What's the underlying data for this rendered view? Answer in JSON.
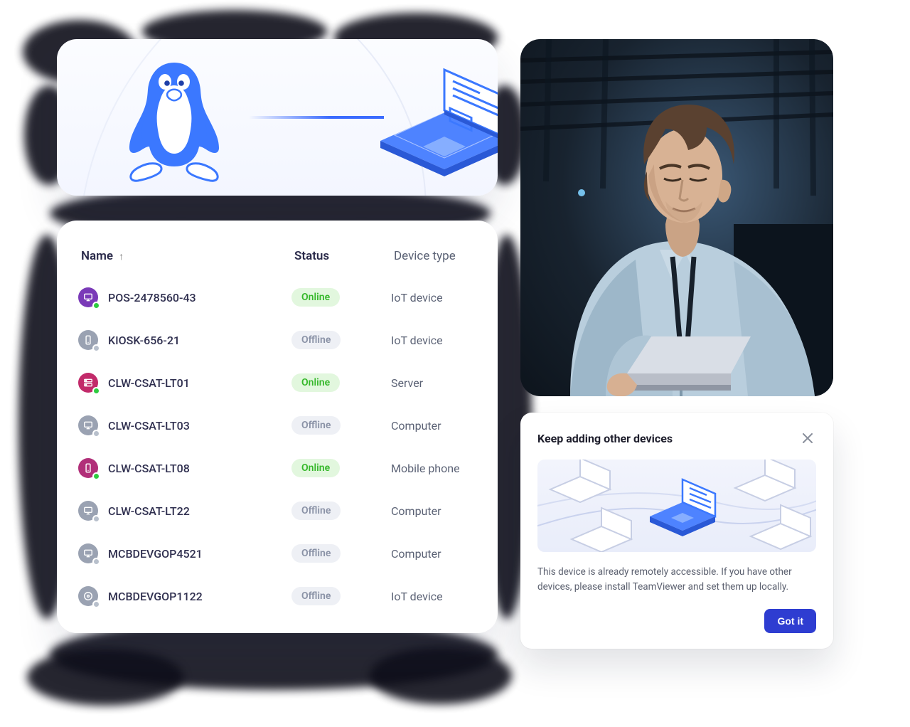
{
  "hero": {
    "source_os_icon": "linux-penguin",
    "target_device_icon": "laptop"
  },
  "table": {
    "headers": {
      "name": "Name",
      "status": "Status",
      "type": "Device type"
    },
    "sort_dir": "asc",
    "status_labels": {
      "online": "Online",
      "offline": "Offline"
    },
    "rows": [
      {
        "name": "POS-2478560-43",
        "status": "online",
        "type": "IoT device",
        "icon_color": "purple",
        "icon_glyph": "monitor"
      },
      {
        "name": "KIOSK-656-21",
        "status": "offline",
        "type": "IoT device",
        "icon_color": "grey",
        "icon_glyph": "phone"
      },
      {
        "name": "CLW-CSAT-LT01",
        "status": "online",
        "type": "Server",
        "icon_color": "pink",
        "icon_glyph": "server"
      },
      {
        "name": "CLW-CSAT-LT03",
        "status": "offline",
        "type": "Computer",
        "icon_color": "grey",
        "icon_glyph": "monitor"
      },
      {
        "name": "CLW-CSAT-LT08",
        "status": "online",
        "type": "Mobile phone",
        "icon_color": "magenta",
        "icon_glyph": "phone"
      },
      {
        "name": "CLW-CSAT-LT22",
        "status": "offline",
        "type": "Computer",
        "icon_color": "grey",
        "icon_glyph": "monitor"
      },
      {
        "name": "MCBDEVGOP4521",
        "status": "offline",
        "type": "Computer",
        "icon_color": "grey",
        "icon_glyph": "monitor"
      },
      {
        "name": "MCBDEVGOP1122",
        "status": "offline",
        "type": "IoT device",
        "icon_color": "grey",
        "icon_glyph": "disc"
      }
    ]
  },
  "dialog": {
    "title": "Keep adding other devices",
    "body": "This device is already remotely accessible. If you have other devices, please install TeamViewer and set them up locally.",
    "primary_button": "Got it"
  },
  "photo": {
    "alt": "Man in light blue shirt holding open laptop in dark industrial room"
  },
  "colors": {
    "accent": "#2e3dd1",
    "online_bg": "#e2f7de",
    "online_fg": "#36b82b",
    "offline_bg": "#eef0f5",
    "offline_fg": "#8a92a6"
  }
}
